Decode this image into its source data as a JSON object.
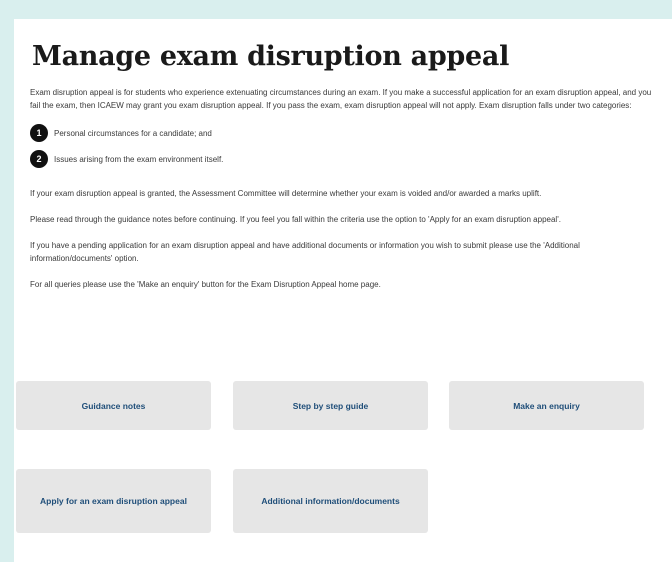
{
  "page": {
    "title": "Manage exam disruption appeal",
    "intro": "Exam disruption appeal is for students who experience extenuating circumstances during an exam. If you make a successful application for an exam disruption appeal, and you fail the exam, then ICAEW may grant you exam disruption appeal. If you pass the exam, exam disruption appeal will not apply. Exam disruption falls under two categories:",
    "categories": [
      {
        "number": "1",
        "text": "Personal circumstances for a candidate; and"
      },
      {
        "number": "2",
        "text": "Issues arising from the exam environment itself."
      }
    ],
    "paragraphs": [
      "If your exam disruption appeal is granted, the Assessment Committee will determine whether your exam is voided and/or awarded a marks uplift.",
      "Please read through the guidance notes before continuing. If you feel you fall within the criteria use the option to 'Apply for an exam disruption appeal'.",
      "If you have a pending application for an exam disruption appeal and have additional documents or information you wish to submit please use the 'Additional information/documents' option.",
      "For all queries please use the 'Make an enquiry' button for the Exam Disruption Appeal home page."
    ]
  },
  "buttons": {
    "guidance_notes": "Guidance notes",
    "step_by_step": "Step by step guide",
    "make_enquiry": "Make an enquiry",
    "apply": "Apply for an exam disruption appeal",
    "additional_info": "Additional information/documents"
  },
  "colors": {
    "background": "#d9efee",
    "button_bg": "#e6e6e6",
    "button_text": "#1f4e79"
  }
}
